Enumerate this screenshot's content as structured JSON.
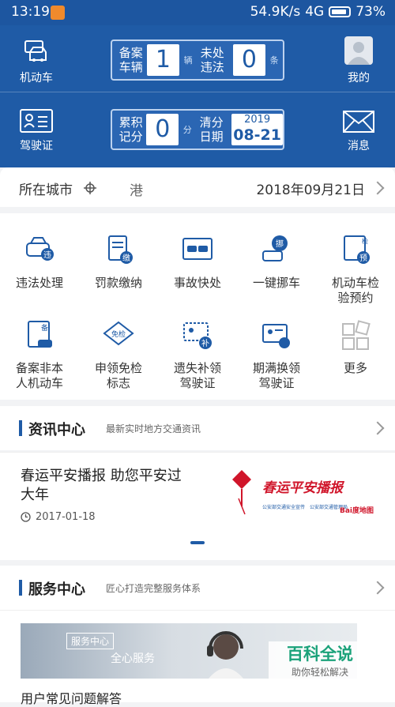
{
  "status": {
    "time": "13:19",
    "speed": "54.9K/s",
    "network": "4G",
    "battery": "73%"
  },
  "header": {
    "vehicle_label": "机动车",
    "license_label": "驾驶证",
    "me_label": "我的",
    "msg_label": "消息",
    "reg_line1": "备案",
    "reg_line2": "车辆",
    "reg_count": "1",
    "reg_unit": "辆",
    "vio_line1": "未处",
    "vio_line2": "违法",
    "vio_count": "0",
    "vio_unit": "条",
    "pts_line1": "累积",
    "pts_line2": "记分",
    "pts_count": "0",
    "pts_unit": "分",
    "clr_line1": "清分",
    "clr_line2": "日期",
    "clr_year": "2019",
    "clr_date": "08-21"
  },
  "city": {
    "label": "所在城市",
    "value": "港",
    "date": "2018年09月21日"
  },
  "services": [
    {
      "label1": "违法处理",
      "label2": ""
    },
    {
      "label1": "罚款缴纳",
      "label2": ""
    },
    {
      "label1": "事故快处",
      "label2": ""
    },
    {
      "label1": "一键挪车",
      "label2": ""
    },
    {
      "label1": "机动车检",
      "label2": "验预约"
    },
    {
      "label1": "备案非本",
      "label2": "人机动车"
    },
    {
      "label1": "申领免检",
      "label2": "标志"
    },
    {
      "label1": "遗失补领",
      "label2": "驾驶证"
    },
    {
      "label1": "期满换领",
      "label2": "驾驶证"
    },
    {
      "label1": "更多",
      "label2": ""
    }
  ],
  "icon_text": {
    "violation": "违",
    "fine": "缴",
    "move": "挪",
    "inspect": "检",
    "pre": "预",
    "filing": "备",
    "exempt": "免检",
    "reissue": "补"
  },
  "news_section": {
    "title": "资讯中心",
    "subtitle": "最新实时地方交通资讯"
  },
  "news": {
    "headline": "春运平安播报 助您平安过大年",
    "date": "2017-01-18",
    "image_text": "春运平安播报",
    "image_sub1": "公安部交通安全宣传",
    "image_sub2": "公安部交通管理局",
    "image_brand": "Bai度地图"
  },
  "service_section": {
    "title": "服务中心",
    "subtitle": "匠心打造完整服务体系"
  },
  "service_banner": {
    "tag": "服务中心",
    "text": "全心服务"
  },
  "faq": "用户常见问题解答",
  "watermark": {
    "brand": "百科全说",
    "slogan": "助你轻松解决"
  },
  "colors": {
    "primary": "#1f5ba6",
    "accent": "#1ba27a"
  }
}
